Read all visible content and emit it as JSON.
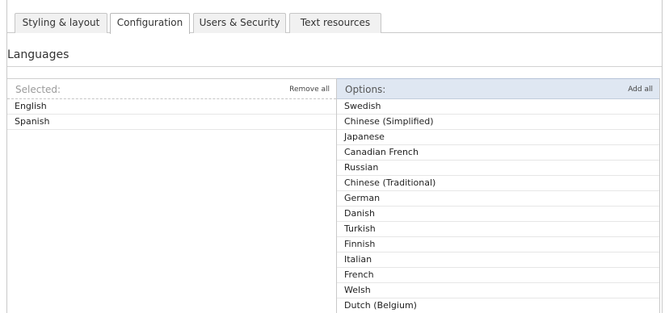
{
  "tabs": [
    {
      "label": "Styling & layout"
    },
    {
      "label": "Configuration"
    },
    {
      "label": "Users & Security"
    },
    {
      "label": "Text resources"
    }
  ],
  "active_tab": "Configuration",
  "section_title": "Languages",
  "selected": {
    "header": "Selected:",
    "action": "Remove all",
    "items": [
      "English",
      "Spanish"
    ]
  },
  "options": {
    "header": "Options:",
    "action": "Add all",
    "items": [
      "Swedish",
      "Chinese (Simplified)",
      "Japanese",
      "Canadian French",
      "Russian",
      "Chinese (Traditional)",
      "German",
      "Danish",
      "Turkish",
      "Finnish",
      "Italian",
      "French",
      "Welsh",
      "Dutch (Belgium)"
    ]
  },
  "colors": {
    "options_header_bg": "#dfe7f2",
    "border": "#c9c9c9"
  }
}
